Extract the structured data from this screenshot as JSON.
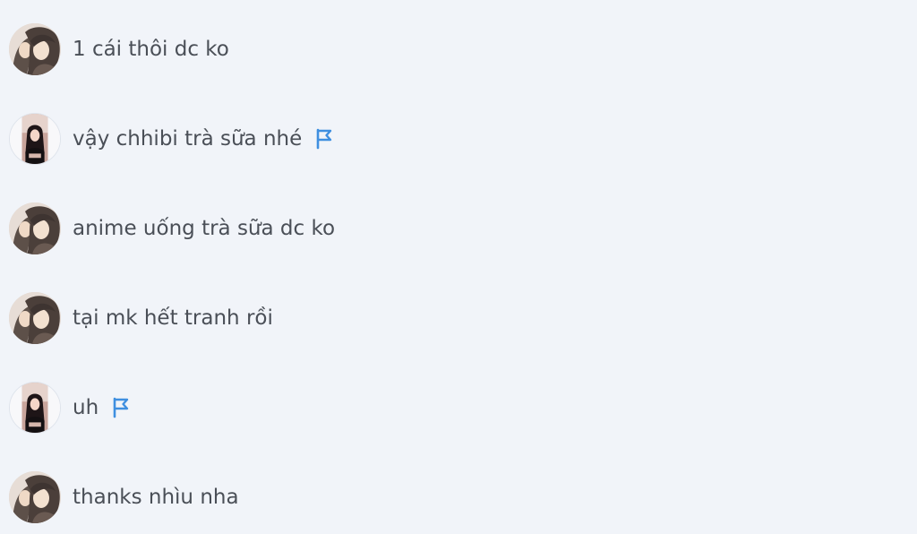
{
  "messages": [
    {
      "text": "1 cái thôi dc ko",
      "avatar": "anime-couple-avatar",
      "flag": false
    },
    {
      "text": "vậy chhibi trà sữa nhé",
      "avatar": "girl-portrait-avatar",
      "flag": true
    },
    {
      "text": "anime uống trà sữa dc ko",
      "avatar": "anime-couple-avatar",
      "flag": false
    },
    {
      "text": "tại mk hết tranh rồi",
      "avatar": "anime-couple-avatar",
      "flag": false
    },
    {
      "text": "uh",
      "avatar": "girl-portrait-avatar",
      "flag": true
    },
    {
      "text": "thanks nhìu nha",
      "avatar": "anime-couple-avatar",
      "flag": false
    }
  ],
  "colors": {
    "background": "#f1f4f9",
    "text": "#4a4f57",
    "flag": "#3f8fe0"
  }
}
